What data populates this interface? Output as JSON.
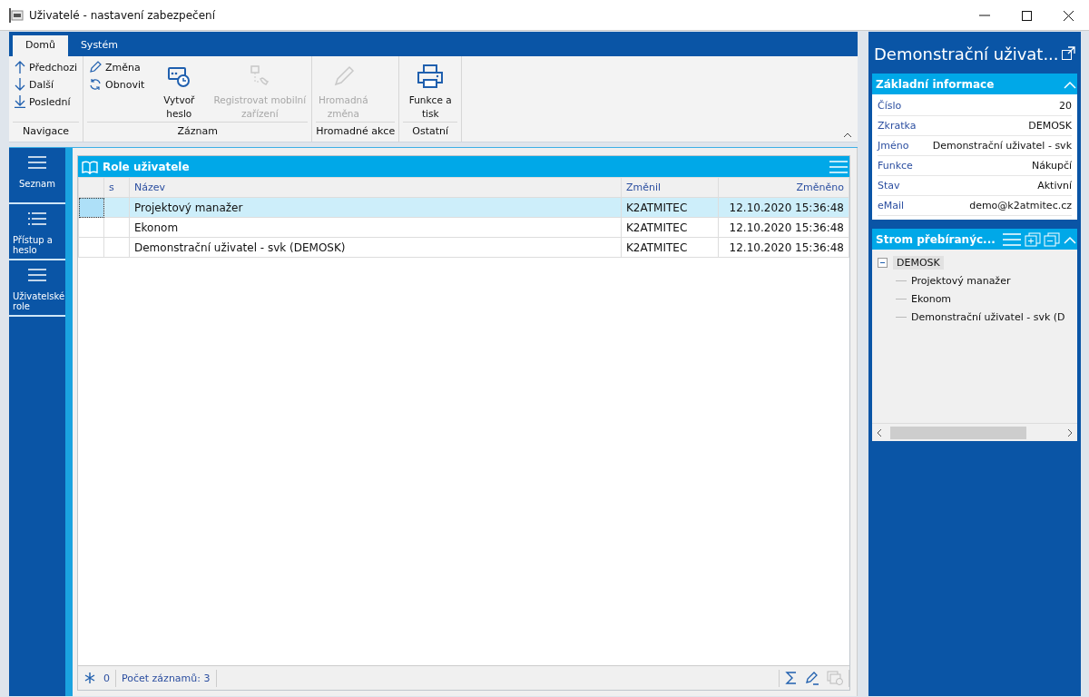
{
  "window": {
    "title": "Uživatelé - nastavení zabezpečení"
  },
  "ribbon": {
    "tabs": [
      {
        "label": "Domů",
        "selected": true
      },
      {
        "label": "Systém",
        "selected": false
      }
    ],
    "groups": [
      {
        "label": "Navigace",
        "buttons": [
          {
            "label": "Předchozi",
            "kind": "small",
            "disabled": false
          },
          {
            "label": "Další",
            "kind": "small",
            "disabled": false
          },
          {
            "label": "Poslední",
            "kind": "small",
            "disabled": false
          }
        ]
      },
      {
        "label": "Záznam",
        "buttons": [
          {
            "label": "Změna",
            "kind": "small",
            "disabled": false
          },
          {
            "label": "Obnovit",
            "kind": "small",
            "disabled": false
          },
          {
            "label": "Vytvoř heslo",
            "kind": "large",
            "disabled": false
          },
          {
            "label": "Registrovat mobilní zařízení",
            "kind": "large",
            "disabled": true
          }
        ]
      },
      {
        "label": "Hromadné akce",
        "buttons": [
          {
            "label": "Hromadná změna",
            "kind": "large",
            "disabled": true
          }
        ]
      },
      {
        "label": "Ostatní",
        "buttons": [
          {
            "label": "Funkce a tisk",
            "kind": "large",
            "disabled": false
          }
        ]
      }
    ]
  },
  "sidebar": {
    "items": [
      {
        "label": "Seznam"
      },
      {
        "label": "Přístup a heslo"
      },
      {
        "label": "Uživatelské role"
      }
    ]
  },
  "grid": {
    "title": "Role uživatele",
    "columns": [
      "s",
      "Název",
      "Změnil",
      "Změněno"
    ],
    "rows": [
      {
        "cells": [
          "",
          "Projektový manažer",
          "K2ATMITEC",
          "12.10.2020 15:36:48"
        ],
        "selected": true
      },
      {
        "cells": [
          "",
          "Ekonom",
          "K2ATMITEC",
          "12.10.2020 15:36:48"
        ],
        "selected": false
      },
      {
        "cells": [
          "",
          "Demonstrační uživatel - svk (DEMOSK)",
          "K2ATMITEC",
          "12.10.2020 15:36:48"
        ],
        "selected": false
      }
    ],
    "status": {
      "filter_count": "0",
      "record_count": "Počet záznamů: 3"
    }
  },
  "detail": {
    "title": "Demonstrační uživat...",
    "info": {
      "title": "Základní informace",
      "fields": [
        {
          "label": "Číslo",
          "value": "20"
        },
        {
          "label": "Zkratka",
          "value": "DEMOSK"
        },
        {
          "label": "Jméno",
          "value": "Demonstrační uživatel - svk"
        },
        {
          "label": "Funkce",
          "value": "Nákupčí"
        },
        {
          "label": "Stav",
          "value": "Aktivní"
        },
        {
          "label": "eMail",
          "value": "demo@k2atmitec.cz"
        }
      ]
    },
    "tree": {
      "title": "Strom přebíranýc...",
      "nodes": [
        {
          "label": "DEMOSK",
          "expanded": true,
          "children": [
            {
              "label": "Projektový manažer"
            },
            {
              "label": "Ekonom"
            },
            {
              "label": "Demonstrační uživatel - svk (D"
            }
          ]
        }
      ]
    }
  }
}
